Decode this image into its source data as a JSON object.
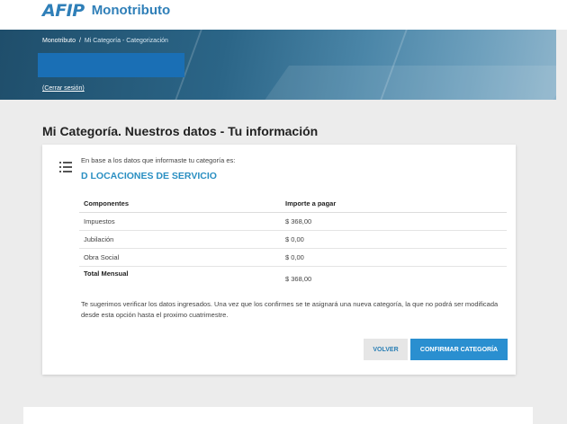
{
  "header": {
    "logo_mark": "AFIP",
    "logo_text": "Monotributo"
  },
  "banner": {
    "breadcrumb": [
      "Monotributo",
      "Mi Categoría - Categorización"
    ],
    "breadcrumb_sep": "/",
    "logout": "(Cerrar sesión)"
  },
  "page": {
    "title": "Mi Categoría. Nuestros datos - Tu información"
  },
  "card": {
    "intro": "En base a los datos que informaste tu categoría es:",
    "category": "D LOCACIONES DE SERVICIO",
    "table": {
      "headers": [
        "Componentes",
        "Importe a pagar"
      ],
      "rows": [
        [
          "Impuestos",
          "$ 368,00"
        ],
        [
          "Jubilación",
          "$ 0,00"
        ],
        [
          "Obra Social",
          "$ 0,00"
        ]
      ],
      "total": [
        "Total Mensual",
        "$ 368,00"
      ]
    },
    "notice": "Te sugerimos verificar los datos ingresados. Una vez que los confirmes se te asignará una nueva categoría, la que no podrá ser modificada desde esta opción hasta el proximo cuatrimestre.",
    "buttons": {
      "back": "VOLVER",
      "confirm": "CONFIRMAR CATEGORÍA"
    }
  },
  "colors": {
    "brand_blue": "#2f7fb8",
    "accent": "#2a8fc2",
    "confirm_button": "#2a8fd0",
    "banner_dark": "#1f4e6b"
  }
}
